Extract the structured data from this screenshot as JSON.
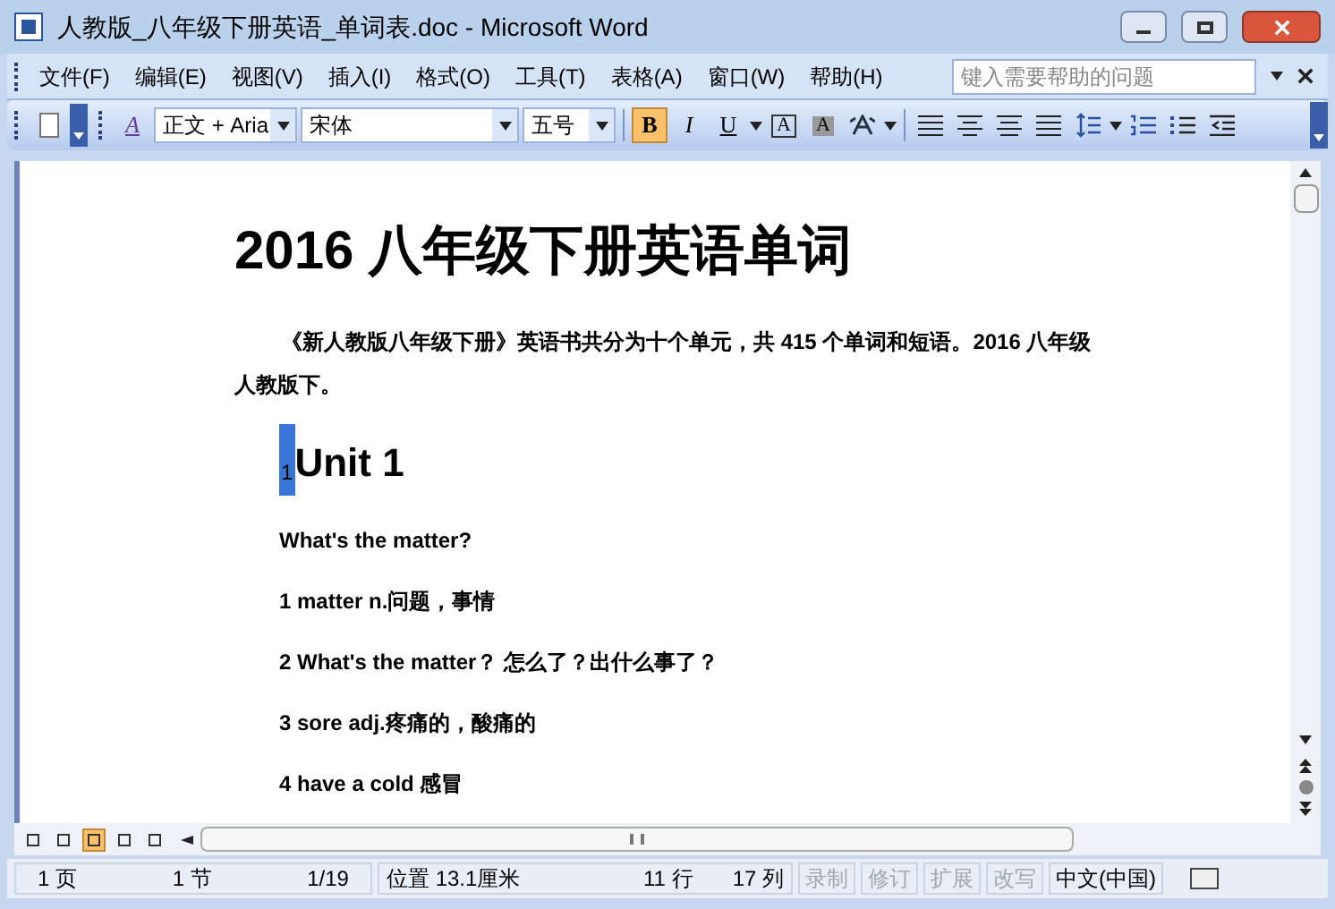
{
  "window": {
    "title": "人教版_八年级下册英语_单词表.doc - Microsoft Word"
  },
  "menu": [
    "文件(F)",
    "编辑(E)",
    "视图(V)",
    "插入(I)",
    "格式(O)",
    "工具(T)",
    "表格(A)",
    "窗口(W)",
    "帮助(H)"
  ],
  "help_search": {
    "placeholder": "键入需要帮助的问题"
  },
  "toolbar": {
    "styles_icon": "A",
    "style": "正文 + Aria",
    "font": "宋体",
    "size": "五号",
    "format_buttons": [
      {
        "kind": "bold",
        "label": "B",
        "selected": true
      },
      {
        "kind": "italic",
        "label": "I",
        "selected": false
      },
      {
        "kind": "underline",
        "label": "U",
        "selected": false
      },
      {
        "kind": "border",
        "label": "A",
        "selected": false
      },
      {
        "kind": "shading",
        "label": "A",
        "selected": false
      }
    ]
  },
  "document": {
    "title": "2016 八年级下册英语单词",
    "intro": "《新人教版八年级下册》英语书共分为十个单元，共 415 个单词和短语。2016 八年级人教版下。",
    "heading_number": "1",
    "heading": "Unit 1",
    "lines": [
      "What's the matter?",
      "1 matter n.问题，事情",
      "2 What's the matter？ 怎么了？出什么事了？",
      "3 sore adj.疼痛的，酸痛的",
      "4 have a cold  感冒"
    ]
  },
  "view_buttons": [
    {
      "selected": false
    },
    {
      "selected": false
    },
    {
      "selected": true
    },
    {
      "selected": false
    },
    {
      "selected": false
    }
  ],
  "status_bar": {
    "page": "1 页",
    "section": "1 节",
    "pages": "1/19",
    "position": "位置 13.1厘米",
    "line": "11 行",
    "column": "17 列",
    "modes": [
      "录制",
      "修订",
      "扩展",
      "改写"
    ],
    "language": "中文(中国)"
  }
}
